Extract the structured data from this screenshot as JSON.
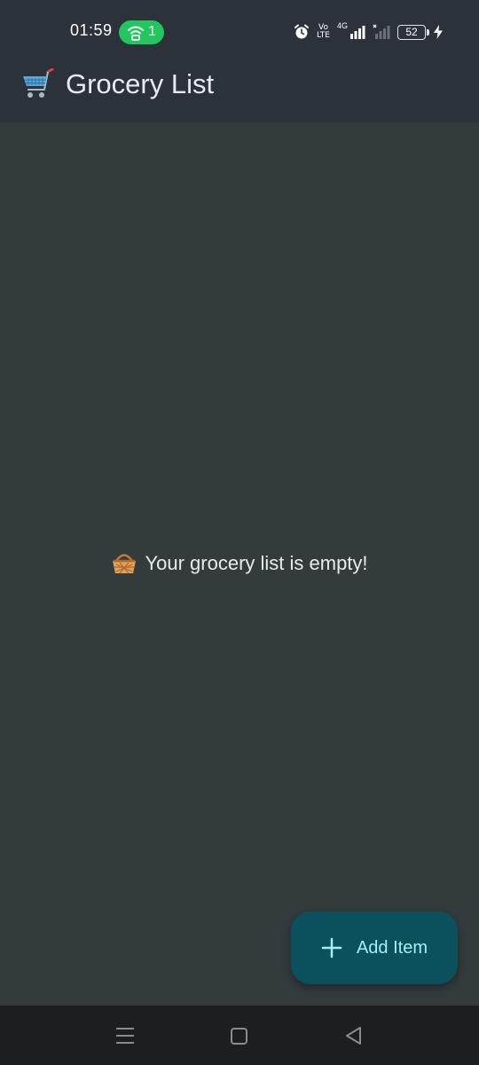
{
  "status_bar": {
    "time": "01:59",
    "hotspot_count": "1",
    "volte_top": "Vo",
    "volte_bottom": "LTE",
    "network_label": "4G",
    "battery_level": "52",
    "icons": [
      "hotspot-icon",
      "alarm-icon",
      "volte-icon",
      "signal-icon",
      "no-signal-icon",
      "battery-icon",
      "charging-icon"
    ]
  },
  "app_bar": {
    "title": "Grocery List",
    "icon": "shopping-cart-icon"
  },
  "empty_state": {
    "message": "Your grocery list is empty!",
    "icon": "basket-icon"
  },
  "fab": {
    "label": "Add Item",
    "icon": "plus-icon"
  },
  "nav_bar": {
    "icons": [
      "menu-icon",
      "home-icon",
      "back-icon"
    ]
  },
  "colors": {
    "status_bar_bg": "#2b323a",
    "app_bar_bg": "#2b323a",
    "content_bg": "#333b3d",
    "fab_bg": "#0a515d",
    "fab_text": "#a9ecf5",
    "hotspot_green": "#22c55e",
    "nav_bar_bg": "#1d1e1f"
  }
}
